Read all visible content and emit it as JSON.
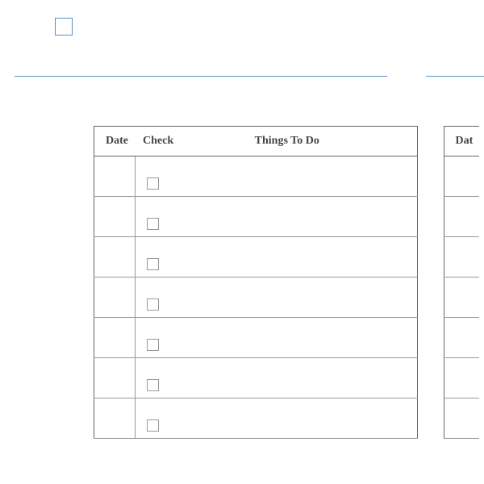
{
  "headers": {
    "date": "Date",
    "check": "Check",
    "things": "Things To Do",
    "date2": "Dat"
  },
  "rows": [
    {
      "date": "",
      "checked": false,
      "task": ""
    },
    {
      "date": "",
      "checked": false,
      "task": ""
    },
    {
      "date": "",
      "checked": false,
      "task": ""
    },
    {
      "date": "",
      "checked": false,
      "task": ""
    },
    {
      "date": "",
      "checked": false,
      "task": ""
    },
    {
      "date": "",
      "checked": false,
      "task": ""
    },
    {
      "date": "",
      "checked": false,
      "task": ""
    }
  ]
}
